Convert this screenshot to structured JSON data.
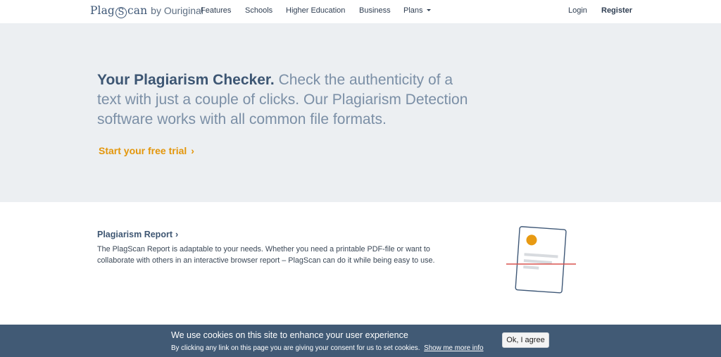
{
  "nav": {
    "logo": {
      "main_prefix": "Plag",
      "main_s": "S",
      "main_suffix": "can",
      "by": "by Ouriginal"
    },
    "items": [
      {
        "label": "Features"
      },
      {
        "label": "Schools"
      },
      {
        "label": "Higher Education"
      },
      {
        "label": "Business"
      },
      {
        "label": "Plans"
      }
    ],
    "login": "Login",
    "register": "Register"
  },
  "hero": {
    "headline_strong": "Your Plagiarism Checker.",
    "headline_rest": " Check the authenticity of a text with just a couple of clicks. Our Plagiarism Detection software works with all common file formats.",
    "cta": "Start your free trial",
    "cta_chevron": "›"
  },
  "feature": {
    "title": "Plagiarism Report",
    "title_chevron": "›",
    "description": "The PlagScan Report is adaptable to your needs. Whether you need a printable PDF-file or want to collaborate with others in an interactive browser report – PlagScan can do it while being easy to use.",
    "illustration": "document-scan-icon"
  },
  "cookie": {
    "title": "We use cookies on this site to enhance your user experience",
    "subtitle": "By clicking any link on this page you are giving your consent for us to set cookies.",
    "link": "Show me more info",
    "button": "Ok, I agree"
  },
  "colors": {
    "brand": "#3f5877",
    "accent": "#e3960b",
    "hero_bg": "#eceff2",
    "cookie_bg": "#415a75",
    "scan_line": "#d9534f"
  }
}
